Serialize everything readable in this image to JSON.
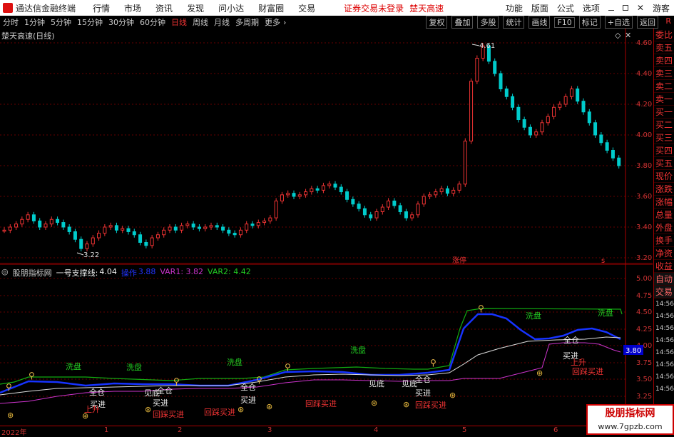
{
  "titlebar": {
    "app_name": "通达信金融终端",
    "menus": [
      "行情",
      "市场",
      "资讯",
      "发现",
      "问小达",
      "财富圈",
      "交易"
    ],
    "warning": "证券交易未登录",
    "stock_name": "楚天高速",
    "right_items": [
      "功能",
      "版面",
      "公式",
      "选项",
      "游客"
    ]
  },
  "periodbar": {
    "periods": [
      "分时",
      "1分钟",
      "5分钟",
      "15分钟",
      "30分钟",
      "60分钟",
      "日线",
      "周线",
      "月线",
      "多周期",
      "更多"
    ],
    "active": "日线",
    "tools": [
      "复权",
      "叠加",
      "多股",
      "统计",
      "画线",
      "F10",
      "标记",
      "+自选",
      "返回"
    ],
    "flag": "R"
  },
  "chart_title": "楚天高速(日线)",
  "price_axis": [
    "4.60",
    "4.40",
    "4.20",
    "4.00",
    "3.80",
    "3.60",
    "3.40",
    "3.20"
  ],
  "price_annotations": {
    "high": "4.61",
    "low": "3.22",
    "event": "涨停"
  },
  "indicator": {
    "name": "股朋指标网",
    "line1_label": "一号支撑线:",
    "line1_value": "4.04",
    "op_label": "操作",
    "op_value": "3.88",
    "var1": "VAR1: 3.82",
    "var2": "VAR2: 4.42",
    "axis": [
      "5.00",
      "4.75",
      "4.50",
      "4.25",
      "4.00",
      "3.75",
      "3.50",
      "3.25"
    ],
    "current_value": "3.80",
    "labels": {
      "wash": "洗盘",
      "full": "全仓",
      "buy": "买进",
      "see_bottom": "见底",
      "pullback_buy": "回踩买进",
      "rise": "上升"
    }
  },
  "side_panel": [
    "委比",
    "卖五",
    "卖四",
    "卖三",
    "卖二",
    "卖一",
    "买一",
    "买二",
    "买三",
    "买四",
    "买五",
    "现价",
    "涨跌",
    "涨幅",
    "总量",
    "外盘",
    "换手",
    "净资",
    "收益",
    "自动",
    "交易"
  ],
  "side_times": [
    "14:56",
    "14:56",
    "14:56",
    "14:56",
    "14:56",
    "14:56",
    "14:56",
    "14:56",
    "14:56"
  ],
  "date_axis": [
    "2022年",
    "1",
    "2",
    "3",
    "4",
    "5",
    "6"
  ],
  "watermark": {
    "big": "股朋指标网",
    "small": "www.7gpzb.com"
  }
}
